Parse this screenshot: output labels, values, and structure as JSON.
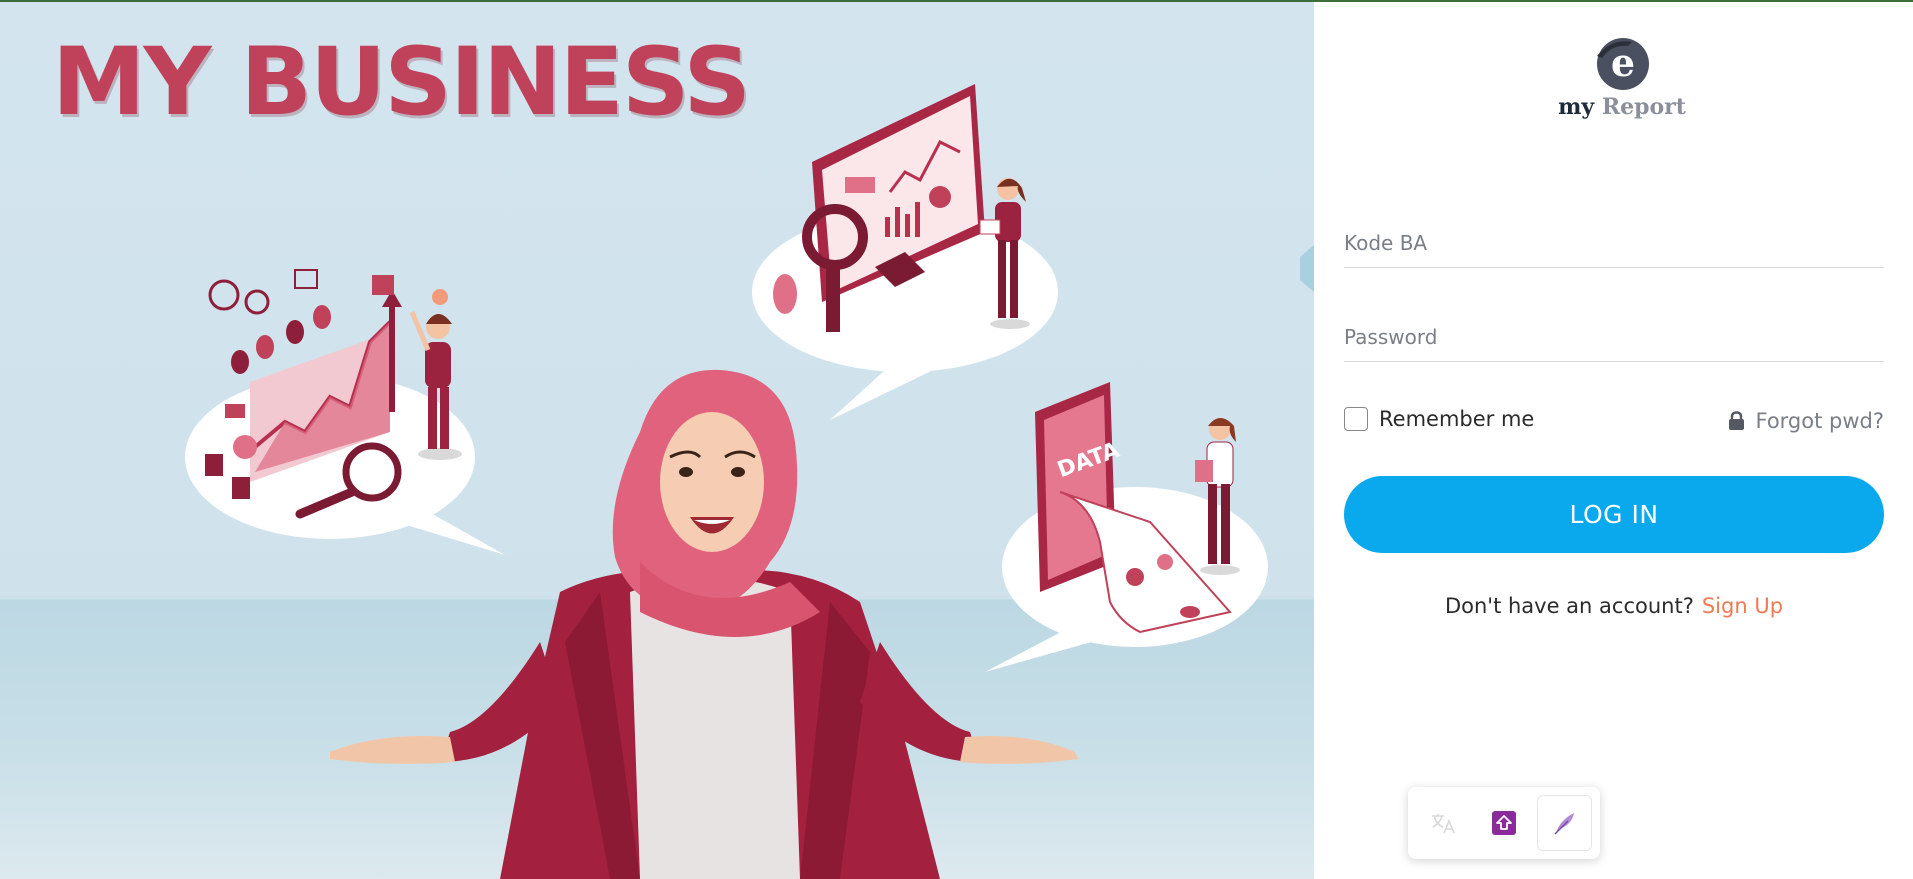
{
  "hero": {
    "title": "MY BUSINESS",
    "phone_label": "DATA"
  },
  "logo": {
    "letter": "e",
    "text_my": "my",
    "text_report": "Report"
  },
  "form": {
    "kode_placeholder": "Kode BA",
    "password_placeholder": "Password",
    "remember_label": "Remember me",
    "remember_checked": false,
    "forgot_label": "Forgot pwd?",
    "login_label": "LOG IN",
    "signup_prompt": "Don't have an account?",
    "signup_link": "Sign Up"
  },
  "toolbar": {
    "items": [
      "translate-icon",
      "upload-icon",
      "feather-icon"
    ]
  },
  "colors": {
    "brand_red": "#c0415a",
    "login_blue": "#0aa9ee",
    "signup_orange": "#f07a55",
    "panel_bg": "#ffffff",
    "hero_sky": "#d3e4ee"
  }
}
